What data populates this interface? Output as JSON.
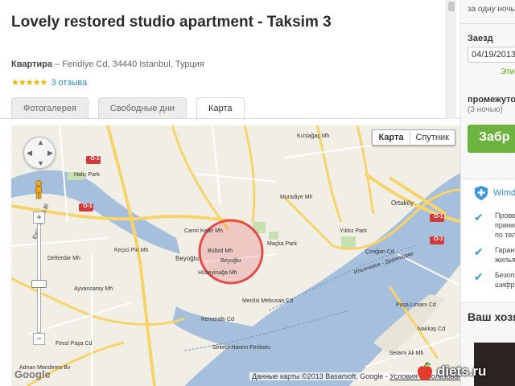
{
  "listing": {
    "title": "Lovely restored studio apartment - Taksim 3",
    "address_type": "Квартира",
    "address_dash": " – ",
    "address_text": "Feridiye Cd, 34440 Istanbul, Турция",
    "stars": "★★★★★",
    "rating_value": 5,
    "reviews_link": "3 отзыва"
  },
  "tabs": [
    {
      "label": "Фотогалерея",
      "active": false
    },
    {
      "label": "Свободные дни",
      "active": false
    },
    {
      "label": "Карта",
      "active": true
    }
  ],
  "map": {
    "type_map": "Карта",
    "type_satellite": "Спутник",
    "logo": "Google",
    "attribution_prefix": "Данные карты ©2013 Basarsoft, Google -",
    "attribution_terms": "Условия использования",
    "labels": {
      "haliç_park": "Haliç Park",
      "ayvansaray": "Ayvansaray Mh",
      "eyup": "Eyüp Sultan Bl",
      "defterdar": "Defterdar Mh",
      "kecici": "Keçici Piri Mh",
      "cami": "Camii Kebir Mh",
      "beyoglu": "Beyoğlu",
      "bulbul": "Bülbül Mh",
      "beyoglu2": "Beyoğlu",
      "huseyinaga": "Hüseyinağa Mh",
      "macka": "Maçka Park",
      "muradiye": "Muradiye Mh",
      "yildiz": "Yıldız Park",
      "ortakoy": "Ortaköy",
      "ciragan": "Çırağan Cd",
      "kizilagac": "Kızılağaç Mh",
      "fevzi": "Fevzi Paşa Cd",
      "adnan": "Adnan Menderes Bv",
      "sirkeci": "Sirkeci-Harem Feribotu",
      "mecidiye": "Meclisi Mebusan Cd",
      "kemeralti": "Kemeraltı Cd",
      "ilyichevsk": "Ильичевск - Деринадже",
      "selimiye": "Selami Ali Mh",
      "pasalimani": "Paşa Limanı Cd",
      "nakkas": "Nakkaş Cd",
      "o1_1": "O-1",
      "o1_2": "O-1",
      "o1_3": "O-1",
      "o1_4": "O-1"
    }
  },
  "sidebar": {
    "top_text": "за одну ночь",
    "checkin_label": "Заезд",
    "checkin_date": "04/19/2013",
    "link_text": "Эти",
    "period_label": "промежуто",
    "nights": "(3 ночью)",
    "book_button": "Забр",
    "wimdu_title": "Wimd",
    "checks": [
      {
        "line1": "Прове",
        "line2": "прини",
        "line3": "по теле"
      },
      {
        "line1": "Гарант",
        "line2": "жилья",
        "line3": ""
      },
      {
        "line1": "Безопа",
        "line2": "шифро",
        "line3": ""
      }
    ],
    "host_title": "Ваш хозя"
  },
  "watermark": {
    "text": "diets.ru"
  },
  "colors": {
    "link": "#2a87c8",
    "star": "#f7b500",
    "book": "#6db33f",
    "water": "#a5bfdd",
    "radius": "#e34b4b"
  }
}
